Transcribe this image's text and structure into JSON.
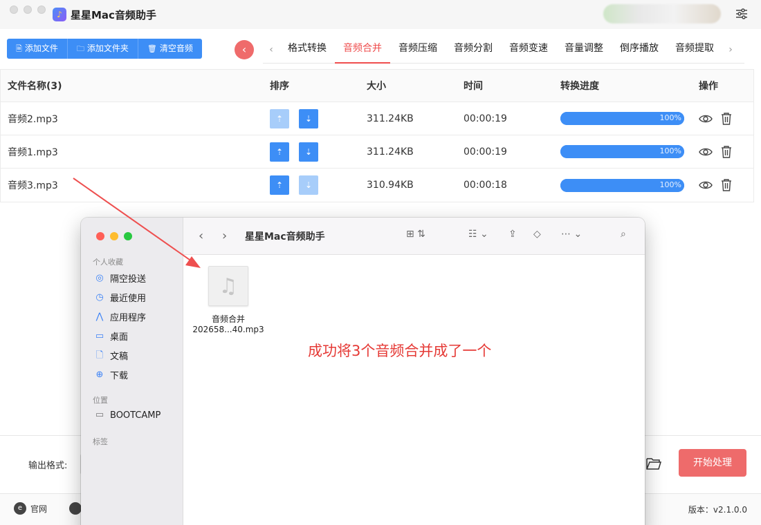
{
  "app": {
    "title": "星星Mac音频助手",
    "logo_glyph": "♪"
  },
  "toolbar": {
    "add_file": "添加文件",
    "add_folder": "添加文件夹",
    "clear": "清空音频",
    "collapse_glyph": "‹"
  },
  "tabs": {
    "prev": "‹",
    "next": "›",
    "items": [
      "格式转换",
      "音频合并",
      "音频压缩",
      "音频分割",
      "音频变速",
      "音量调整",
      "倒序播放",
      "音频提取"
    ],
    "active_index": 1
  },
  "table": {
    "headers": {
      "name": "文件名称(3)",
      "sort": "排序",
      "size": "大小",
      "time": "时间",
      "progress": "转换进度",
      "ops": "操作"
    },
    "rows": [
      {
        "name": "音频2.mp3",
        "size": "311.24KB",
        "time": "00:00:19",
        "progress_label": "100%",
        "progress": 1.0,
        "up_enabled": false,
        "down_enabled": true
      },
      {
        "name": "音频1.mp3",
        "size": "311.24KB",
        "time": "00:00:19",
        "progress_label": "100%",
        "progress": 1.0,
        "up_enabled": true,
        "down_enabled": true
      },
      {
        "name": "音频3.mp3",
        "size": "310.94KB",
        "time": "00:00:18",
        "progress_label": "100%",
        "progress": 1.0,
        "up_enabled": true,
        "down_enabled": false
      }
    ]
  },
  "bottom": {
    "output_format_label": "输出格式:",
    "start_button": "开始处理"
  },
  "footer": {
    "site_label": "官网",
    "version": "版本：v2.1.0.0"
  },
  "finder": {
    "title": "星星Mac音频助手",
    "sections": {
      "favorites": "个人收藏",
      "locations": "位置",
      "tags": "标签"
    },
    "favorites": [
      {
        "label": "隔空投送",
        "icon": "airdrop-icon"
      },
      {
        "label": "最近使用",
        "icon": "clock-icon"
      },
      {
        "label": "应用程序",
        "icon": "applications-icon"
      },
      {
        "label": "桌面",
        "icon": "desktop-icon"
      },
      {
        "label": "文稿",
        "icon": "document-icon"
      },
      {
        "label": "下载",
        "icon": "download-icon"
      }
    ],
    "locations": [
      {
        "label": "BOOTCAMP",
        "icon": "disk-icon"
      }
    ],
    "file": {
      "name_line1": "音频合并",
      "name_line2": "202658...40.mp3"
    }
  },
  "annotation": {
    "text": "成功将3个音频合并成了一个",
    "color": "#e53935"
  },
  "colors": {
    "primary": "#3d8ef6",
    "danger": "#ee6b6b",
    "tab_active": "#ef4d4d"
  }
}
